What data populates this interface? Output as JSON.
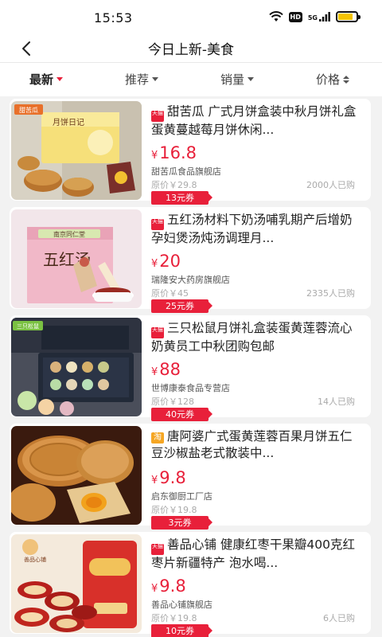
{
  "status_bar": {
    "time": "15:53",
    "hd_label": "HD",
    "network_label": "5G",
    "icons": [
      "wifi-icon",
      "hd-icon",
      "signal-5g-icon",
      "battery-icon"
    ],
    "battery_level": 0.8,
    "battery_color": "#f5c400"
  },
  "header": {
    "back_icon": "chevron-left-icon",
    "title": "今日上新-美食"
  },
  "sort_bar": {
    "items": [
      {
        "label": "最新",
        "active": true
      },
      {
        "label": "推荐",
        "active": false
      },
      {
        "label": "销量",
        "active": false
      },
      {
        "label": "价格",
        "active": false
      }
    ]
  },
  "colors": {
    "accent": "#e8203a",
    "tmall_badge": "#e8203a",
    "taobao_badge": "#f5a623"
  },
  "products": [
    {
      "badge": "天猫",
      "badge_type": "tmall",
      "title": "甜苦瓜 广式月饼盒装中秋月饼礼盒蛋黄蔓越莓月饼休闲...",
      "currency": "¥",
      "price": "16.8",
      "store": "甜苦瓜食品旗舰店",
      "original_price": "原价￥29.8",
      "sold": "2000人已购",
      "coupon": "13元券",
      "image_brand": "甜苦瓜",
      "image_text": "月饼日记"
    },
    {
      "badge": "天猫",
      "badge_type": "tmall",
      "title": "五红汤材料下奶汤哺乳期产后增奶孕妇煲汤炖汤调理月...",
      "currency": "¥",
      "price": "20",
      "store": "瑞隆安大药房旗舰店",
      "original_price": "原价￥45",
      "sold": "2335人已购",
      "coupon": "25元券",
      "image_brand": "南京同仁堂",
      "image_text": "五红汤"
    },
    {
      "badge": "天猫",
      "badge_type": "tmall",
      "title": "三只松鼠月饼礼盒装蛋黄莲蓉流心奶黄员工中秋团购包邮",
      "currency": "¥",
      "price": "88",
      "store": "世博康泰食品专营店",
      "original_price": "原价￥128",
      "sold": "14人已购",
      "coupon": "40元券",
      "image_brand": "三只松鼠",
      "image_text": ""
    },
    {
      "badge": "淘",
      "badge_type": "taobao",
      "title": "唐阿婆广式蛋黄莲蓉百果月饼五仁豆沙椒盐老式散装中...",
      "currency": "¥",
      "price": "9.8",
      "store": "启东御厨工厂店",
      "original_price": "原价￥19.8",
      "sold": "",
      "coupon": "3元券",
      "image_brand": "",
      "image_text": ""
    },
    {
      "badge": "天猫",
      "badge_type": "tmall",
      "title": "善品心铺 健康红枣干果瓣400克红枣片新疆特产 泡水喝...",
      "currency": "¥",
      "price": "9.8",
      "store": "善品心铺旗舰店",
      "original_price": "原价￥19.8",
      "sold": "6人已购",
      "coupon": "10元券",
      "image_brand": "善品心铺",
      "image_text": ""
    }
  ]
}
